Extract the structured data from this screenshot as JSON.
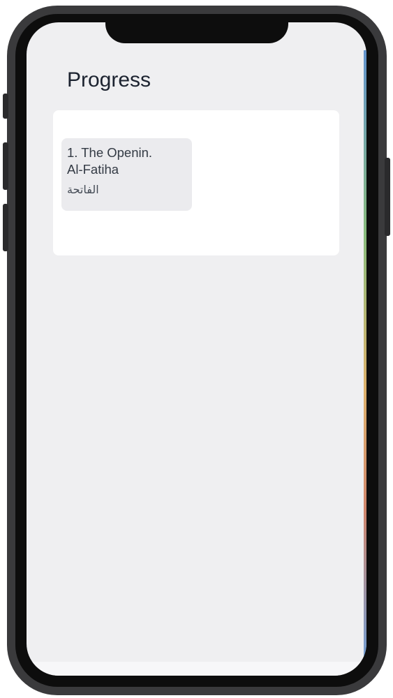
{
  "page": {
    "title": "Progress"
  },
  "progress": {
    "items": [
      {
        "name": "1. The Openin.",
        "transliteration": "Al-Fatiha",
        "arabic": "الفاتحة"
      }
    ]
  }
}
